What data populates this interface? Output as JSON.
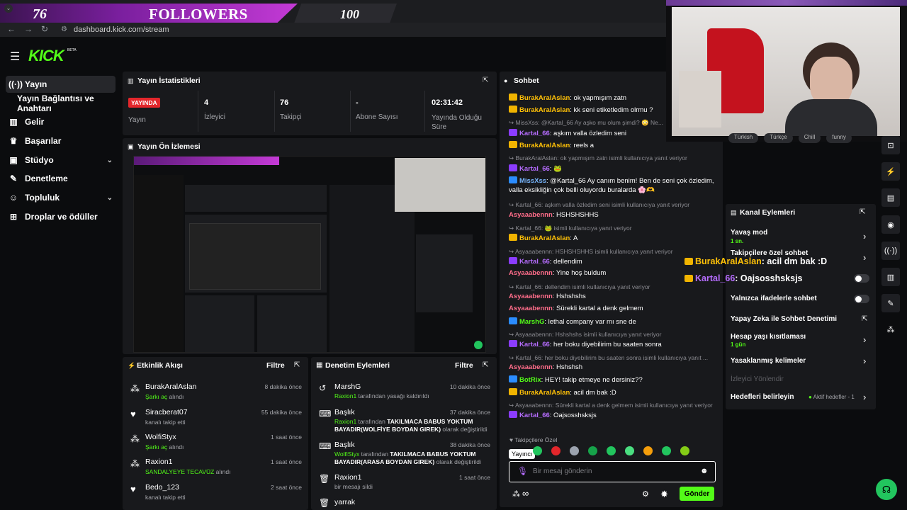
{
  "overlay": {
    "left_num": "76",
    "title": "FOLLOWERS",
    "right_num": "100"
  },
  "browser": {
    "url": "dashboard.kick.com/stream"
  },
  "brand": {
    "logo": "KICK",
    "beta": "BETA"
  },
  "sidebar": {
    "items": [
      {
        "label": "Yayın",
        "icon": "broadcast-icon"
      },
      {
        "label": "Yayın Bağlantısı ve Anahtarı"
      },
      {
        "label": "Gelir",
        "icon": "chart-icon"
      },
      {
        "label": "Başarılar",
        "icon": "trophy-icon"
      },
      {
        "label": "Stüdyo",
        "icon": "camera-icon"
      },
      {
        "label": "Denetleme",
        "icon": "wrench-icon"
      },
      {
        "label": "Topluluk",
        "icon": "users-icon"
      },
      {
        "label": "Droplar ve ödüller",
        "icon": "gift-icon"
      }
    ]
  },
  "stats": {
    "title": "Yayın İstatistikleri",
    "live_badge": "YAYINDA",
    "status_label": "Yayın",
    "viewers_value": "4",
    "viewers_label": "İzleyici",
    "followers_value": "76",
    "followers_label": "Takipçi",
    "subs_value": "-",
    "subs_label": "Abone Sayısı",
    "duration_value": "02:31:42",
    "duration_label": "Yayında Olduğu Süre"
  },
  "preview": {
    "title": "Yayın Ön İzlemesi"
  },
  "activity": {
    "title": "Etkinlik Akışı",
    "filter": "Filtre",
    "rows": [
      {
        "name": "BurakAralAslan",
        "highlight": "Şarkı aç",
        "rest": " alındı",
        "time": "8 dakika önce",
        "icon": "users-icon"
      },
      {
        "name": "Siracberat07",
        "highlight": "",
        "rest": "kanalı takip etti",
        "time": "55 dakika önce",
        "icon": "heart-icon"
      },
      {
        "name": "WolfiStyx",
        "highlight": "Şarkı aç",
        "rest": " alındı",
        "time": "1 saat önce",
        "icon": "users-icon"
      },
      {
        "name": "Raxion1",
        "highlight": "SANDALYEYE TECAVÜZ",
        "rest": " alındı",
        "time": "1 saat önce",
        "icon": "users-icon"
      },
      {
        "name": "Bedo_123",
        "highlight": "",
        "rest": "kanalı takip etti",
        "time": "2 saat önce",
        "icon": "heart-icon"
      }
    ]
  },
  "moderation": {
    "title": "Denetim Eylemleri",
    "filter": "Filtre",
    "rows": [
      {
        "name": "MarshG",
        "user": "Raxion1",
        "rest": " tarafından yasağı kaldırıldı",
        "time": "10 dakika önce"
      },
      {
        "name": "Başlık",
        "user": "Raxion1",
        "rest": " tarafından ",
        "bold": "TAKILMACA BABUS YOKTUM BAYADIR(WOLFİYE BOYDAN GIREK)",
        "tail": " olarak değiştirildi",
        "time": "37 dakika önce"
      },
      {
        "name": "Başlık",
        "user": "WolfiStyx",
        "rest": " tarafından ",
        "bold": "TAKILMACA BABUS YOKTUM BAYADIR(ARASA BOYDAN GIREK)",
        "tail": " olarak değiştirildi",
        "time": "38 dakika önce"
      },
      {
        "name": "Raxion1",
        "user": "",
        "rest": "bir mesajı sildi",
        "time": "1 saat önce"
      },
      {
        "name": "yarrak",
        "user": "",
        "rest": "",
        "time": ""
      }
    ]
  },
  "chat": {
    "title": "Sohbet",
    "lines": [
      {
        "type": "msg",
        "user": "BurakAralAslan",
        "cls": "u-burak",
        "badge": "b-y",
        "text": ": ok yapmışım zatn"
      },
      {
        "type": "msg",
        "user": "BurakAralAslan",
        "cls": "u-burak",
        "badge": "b-y",
        "text": ": kk seni etiketledim olrmu ?"
      },
      {
        "type": "reply",
        "text": "MissXss: @Kartal_66 Ay aşko mu olum şimdi? 😳 Ne..."
      },
      {
        "type": "msg",
        "user": "Kartal_66",
        "cls": "u-kartal",
        "badge": "b-p",
        "text": ": aşkım valla özledim seni"
      },
      {
        "type": "msg",
        "user": "BurakAralAslan",
        "cls": "u-burak",
        "badge": "b-y",
        "text": ": reels a"
      },
      {
        "type": "reply",
        "text": "BurakAralAslan: ok yapmışım zatn isimli kullanıcıya yanıt veriyor"
      },
      {
        "type": "msg",
        "user": "Kartal_66",
        "cls": "u-kartal",
        "badge": "b-p",
        "text": ": 🐸"
      },
      {
        "type": "msg",
        "user": "MissXss",
        "cls": "u-miss",
        "badge": "b-b",
        "text": ": @Kartal_66 Ay canım benim! Ben de seni çok özledim,"
      },
      {
        "type": "cont",
        "text": "valla eksikliğin çok belli oluyordu buralarda 🌸🫶"
      },
      {
        "type": "reply",
        "text": "Kartal_66: aşkım valla özledim seni isimli kullanıcıya yanıt veriyor"
      },
      {
        "type": "msg",
        "user": "Asyaaabennn",
        "cls": "u-asya",
        "badge": "",
        "text": ": HSHSHSHHS"
      },
      {
        "type": "reply",
        "text": "Kartal_66: 🐸 isimli kullanıcıya yanıt veriyor"
      },
      {
        "type": "msg",
        "user": "BurakAralAslan",
        "cls": "u-burak",
        "badge": "b-y",
        "text": ": A"
      },
      {
        "type": "reply",
        "text": "Asyaaabennn: HSHSHSHHS isimli kullanıcıya yanıt veriyor"
      },
      {
        "type": "msg",
        "user": "Kartal_66",
        "cls": "u-kartal",
        "badge": "b-p",
        "text": ": dellendim"
      },
      {
        "type": "msg",
        "user": "Asyaaabennn",
        "cls": "u-asya",
        "badge": "",
        "text": ": Yine hoş buldum"
      },
      {
        "type": "reply",
        "text": "Kartal_66: dellendim isimli kullanıcıya yanıt veriyor"
      },
      {
        "type": "msg",
        "user": "Asyaaabennn",
        "cls": "u-asya",
        "badge": "",
        "text": ": Hshshshs"
      },
      {
        "type": "msg",
        "user": "Asyaaabennn",
        "cls": "u-asya",
        "badge": "",
        "text": ": Sürekli kartal a denk gelmem"
      },
      {
        "type": "msg",
        "user": "MarshG",
        "cls": "u-marsh",
        "badge": "b-b",
        "text": ": lethal company var mı sne de"
      },
      {
        "type": "reply",
        "text": "Asyaaabennn: Hshshshs isimli kullanıcıya yanıt veriyor"
      },
      {
        "type": "msg",
        "user": "Kartal_66",
        "cls": "u-kartal",
        "badge": "b-p",
        "text": ": her boku diyebilirim bu saaten sonra"
      },
      {
        "type": "reply",
        "text": "Kartal_66: her boku diyebilirim bu saaten sonra isimli kullanıcıya yanıt ..."
      },
      {
        "type": "msg",
        "user": "Asyaaabennn",
        "cls": "u-asya",
        "badge": "",
        "text": ": Hshshsh"
      },
      {
        "type": "msg",
        "user": "BotRix",
        "cls": "u-marsh",
        "badge": "b-b",
        "text": ": HEY! takip etmeye ne dersiniz??"
      },
      {
        "type": "msg",
        "user": "BurakAralAslan",
        "cls": "u-burak",
        "badge": "b-y",
        "text": ": acil dm bak :D"
      },
      {
        "type": "reply",
        "text": "Asyaaabennn: Sürekli kartal a denk gelmem isimli kullanıcıya yanıt veriyor"
      },
      {
        "type": "msg",
        "user": "Kartal_66",
        "cls": "u-kartal",
        "badge": "b-p",
        "text": ": Oajsosshsksjs"
      }
    ],
    "followers_only": "Takipçilere Özel",
    "tooltip": "Yayıncı",
    "input_placeholder": "Bir mesaj gönderin",
    "infinity": "∞",
    "send": "Gönder"
  },
  "overlay_chat": [
    {
      "user": "BurakAralAslan",
      "text": ": acil dm bak :D"
    },
    {
      "user": "Kartal_66",
      "text": ": Oajsosshsksjs"
    }
  ],
  "tags": [
    "Türkish",
    "Türkçe",
    "Chill",
    "funny"
  ],
  "channel_actions": {
    "title": "Kanal Eylemleri",
    "items": [
      {
        "label": "Yavaş mod",
        "sub": "1 sn."
      },
      {
        "label": "Takipçilere özel sohbet",
        "sub": ""
      },
      {
        "label": "",
        "sub": ""
      },
      {
        "label": "Yalnızca ifadelerle sohbet",
        "sub": ""
      },
      {
        "label": "Yapay Zeka ile Sohbet Denetimi",
        "sub": ""
      },
      {
        "label": "Hesap yaşı kısıtlaması",
        "sub": "1 gün"
      },
      {
        "label": "Yasaklanmış kelimeler",
        "sub": ""
      },
      {
        "label": "İzleyici Yönlendir",
        "sub": ""
      },
      {
        "label": "Hedefleri belirleyin",
        "sub": ""
      }
    ],
    "active_goals": "Aktif hedefler - 1"
  },
  "colors": {
    "accent": "#53fc18",
    "bg": "#0b0c0e",
    "panel": "#18191c",
    "live": "#e3262b"
  }
}
